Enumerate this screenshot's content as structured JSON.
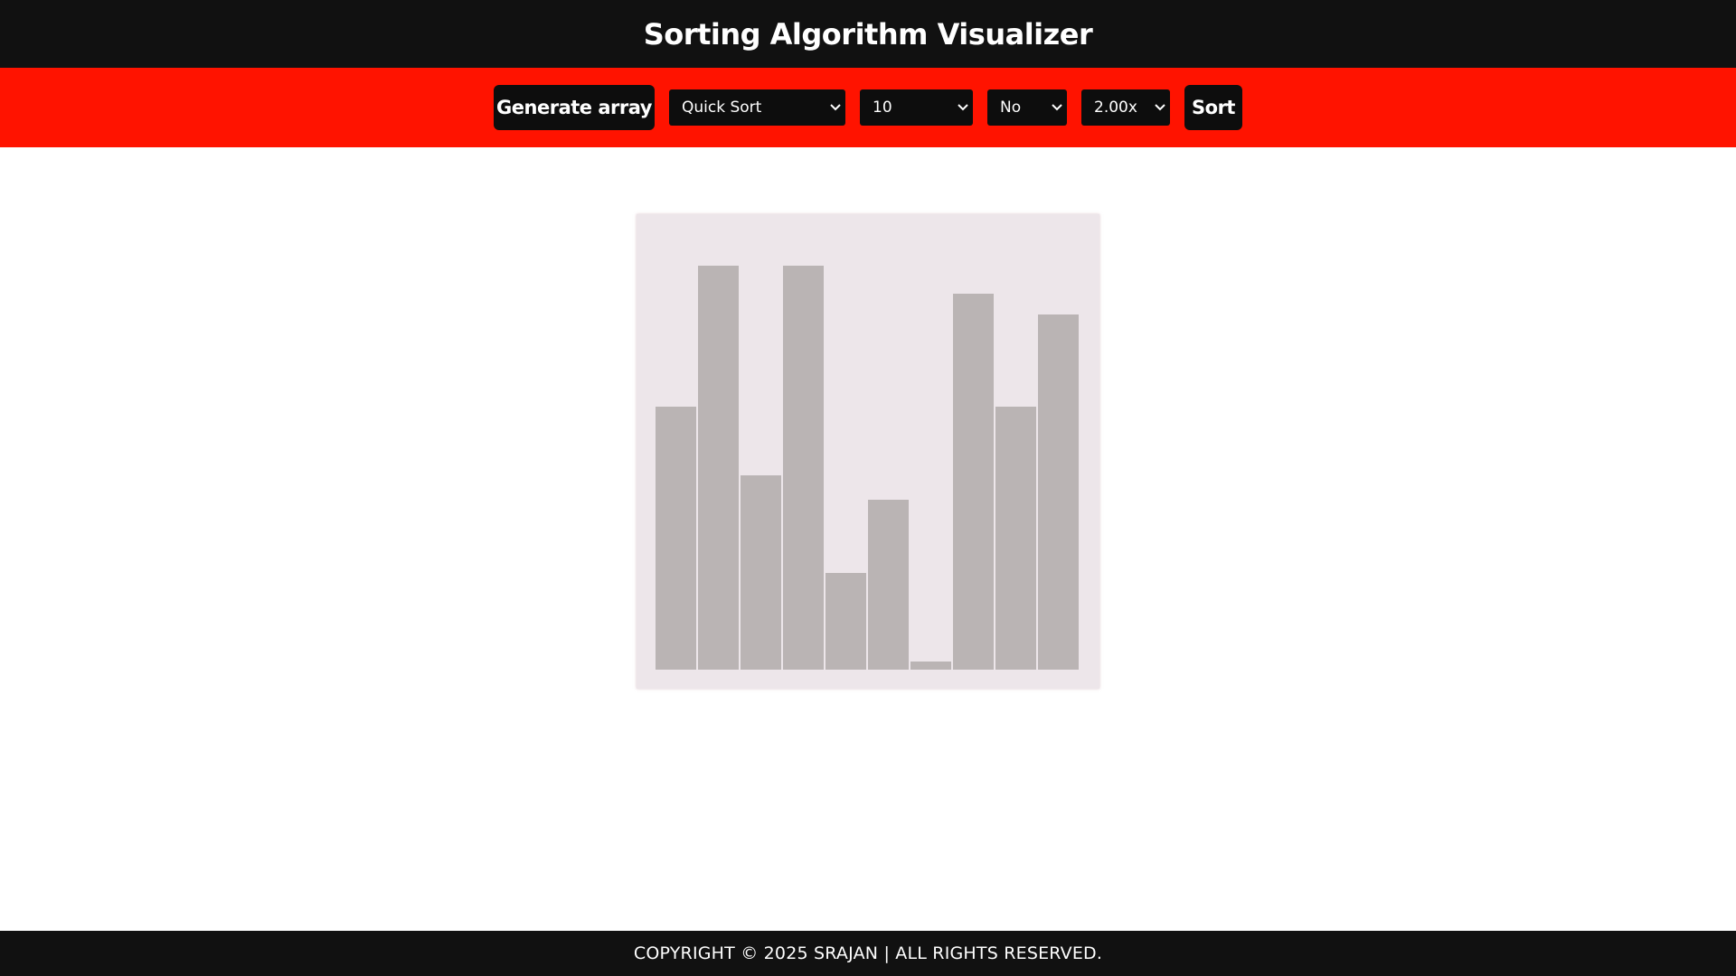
{
  "header": {
    "title": "Sorting Algorithm Visualizer"
  },
  "toolbar": {
    "generate_label": "Generate array",
    "algorithm": "Quick Sort",
    "size": "10",
    "option": "No",
    "speed": "2.00x",
    "sort_label": "Sort"
  },
  "colors": {
    "header_bg": "#111111",
    "toolbar_bg": "#ff1300",
    "button_bg": "#0d0d0d",
    "canvas_bg": "#ede6ea",
    "bar_color": "#bab4b4"
  },
  "array": {
    "values": [
      65,
      100,
      48,
      100,
      24,
      42,
      2,
      93,
      65,
      88
    ],
    "max": 100
  },
  "footer": {
    "text": "COPYRIGHT © 2025 SRAJAN | ALL RIGHTS RESERVED."
  }
}
